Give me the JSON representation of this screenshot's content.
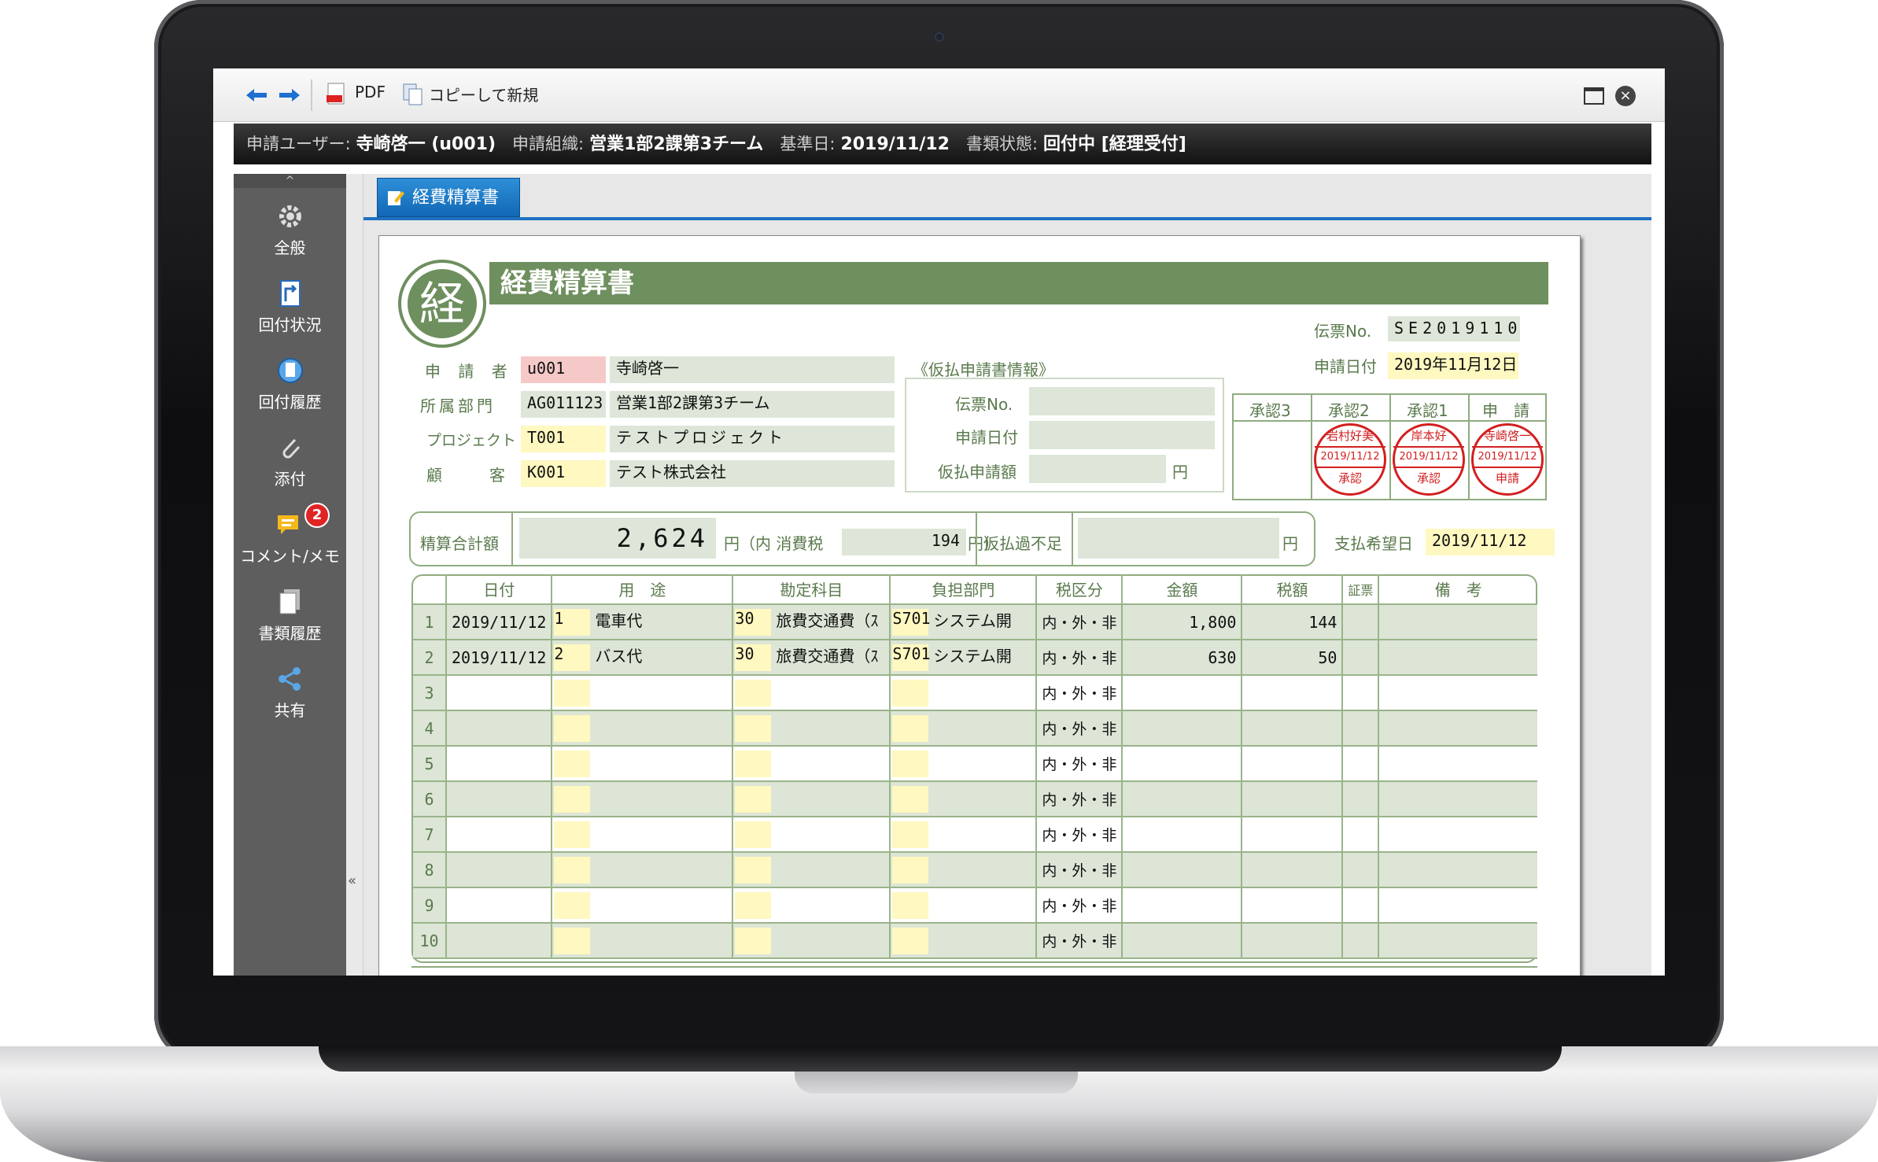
{
  "toolbar": {
    "pdf_label": "PDF",
    "copy_label": "コピーして新規"
  },
  "infobar": {
    "user_label": "申請ユーザー:",
    "user_value": "寺崎啓一 (u001)",
    "org_label": "申請組織:",
    "org_value": "営業1部2課第3チーム",
    "date_label": "基準日:",
    "date_value": "2019/11/12",
    "status_label": "書類状態:",
    "status_value": "回付中 [経理受付]"
  },
  "sidebar": {
    "items": [
      {
        "label": "全般",
        "icon": "gear-icon"
      },
      {
        "label": "回付状況",
        "icon": "route-icon"
      },
      {
        "label": "回付履歴",
        "icon": "history-icon"
      },
      {
        "label": "添付",
        "icon": "paperclip-icon"
      },
      {
        "label": "コメント/メモ",
        "icon": "comment-icon",
        "badge": "2"
      },
      {
        "label": "書類履歴",
        "icon": "document-history-icon"
      },
      {
        "label": "共有",
        "icon": "share-icon"
      }
    ],
    "collapse": "«",
    "scroll_up": "^"
  },
  "tab": {
    "label": "経費精算書"
  },
  "form": {
    "logo_char": "経",
    "title": "経費精算書",
    "slip_no_label": "伝票No.",
    "slip_no": "SE2019110",
    "apply_date_label": "申請日付",
    "apply_date": "2019年11月12日",
    "applicant_label": "申 請 者",
    "applicant_code": "u001",
    "applicant_name": "寺崎啓一",
    "dept_label": "所属部門",
    "dept_code": "AG011123",
    "dept_name": "営業1部2課第3チーム",
    "project_label": "プロジェクト",
    "project_code": "T001",
    "project_name": "テストプロジェクト",
    "customer_label": "顧　客",
    "customer_code": "K001",
    "customer_name": "テスト株式会社",
    "advance_title": "《仮払申請書情報》",
    "advance_no_label": "伝票No.",
    "advance_date_label": "申請日付",
    "advance_amount_label": "仮払申請額",
    "yen": "円",
    "approval_headers": [
      "承認3",
      "承認2",
      "承認1",
      "申　請"
    ],
    "stamps": [
      {
        "name": "岩村好美",
        "date": "2019/11/12",
        "action": "承認"
      },
      {
        "name": "岸本好",
        "date": "2019/11/12",
        "action": "承認"
      },
      {
        "name": "寺崎啓一",
        "date": "2019/11/12",
        "action": "申請"
      }
    ],
    "total_label": "精算合計額",
    "total": "2,624",
    "tax_paren": "円（内 消費税",
    "tax": "194",
    "tax_close": "円）",
    "diff_label": "仮払過不足",
    "diff_yen": "円",
    "pay_date_label": "支払希望日",
    "pay_date": "2019/11/12"
  },
  "table": {
    "headers": [
      "日付",
      "用　途",
      "勘定科目",
      "負担部門",
      "税区分",
      "金額",
      "税額",
      "証票",
      "備　考"
    ],
    "rows": [
      {
        "no": "1",
        "date": "2019/11/12",
        "use_code": "1",
        "use": "電車代",
        "acct_code": "30",
        "acct": "旅費交通費（ｽ",
        "dept_code": "S701",
        "dept": "システム開",
        "tax": "内・外・非",
        "amount": "1,800",
        "taxamt": "144"
      },
      {
        "no": "2",
        "date": "2019/11/12",
        "use_code": "2",
        "use": "バス代",
        "acct_code": "30",
        "acct": "旅費交通費（ｽ",
        "dept_code": "S701",
        "dept": "システム開",
        "tax": "内・外・非",
        "amount": "630",
        "taxamt": "50"
      },
      {
        "no": "3",
        "tax": "内・外・非"
      },
      {
        "no": "4",
        "tax": "内・外・非"
      },
      {
        "no": "5",
        "tax": "内・外・非"
      },
      {
        "no": "6",
        "tax": "内・外・非"
      },
      {
        "no": "7",
        "tax": "内・外・非"
      },
      {
        "no": "8",
        "tax": "内・外・非"
      },
      {
        "no": "9",
        "tax": "内・外・非"
      },
      {
        "no": "10",
        "tax": "内・外・非"
      }
    ]
  },
  "colors": {
    "accent": "#6e8f5e",
    "tab": "#1d72c0",
    "stamp": "#d22020"
  }
}
